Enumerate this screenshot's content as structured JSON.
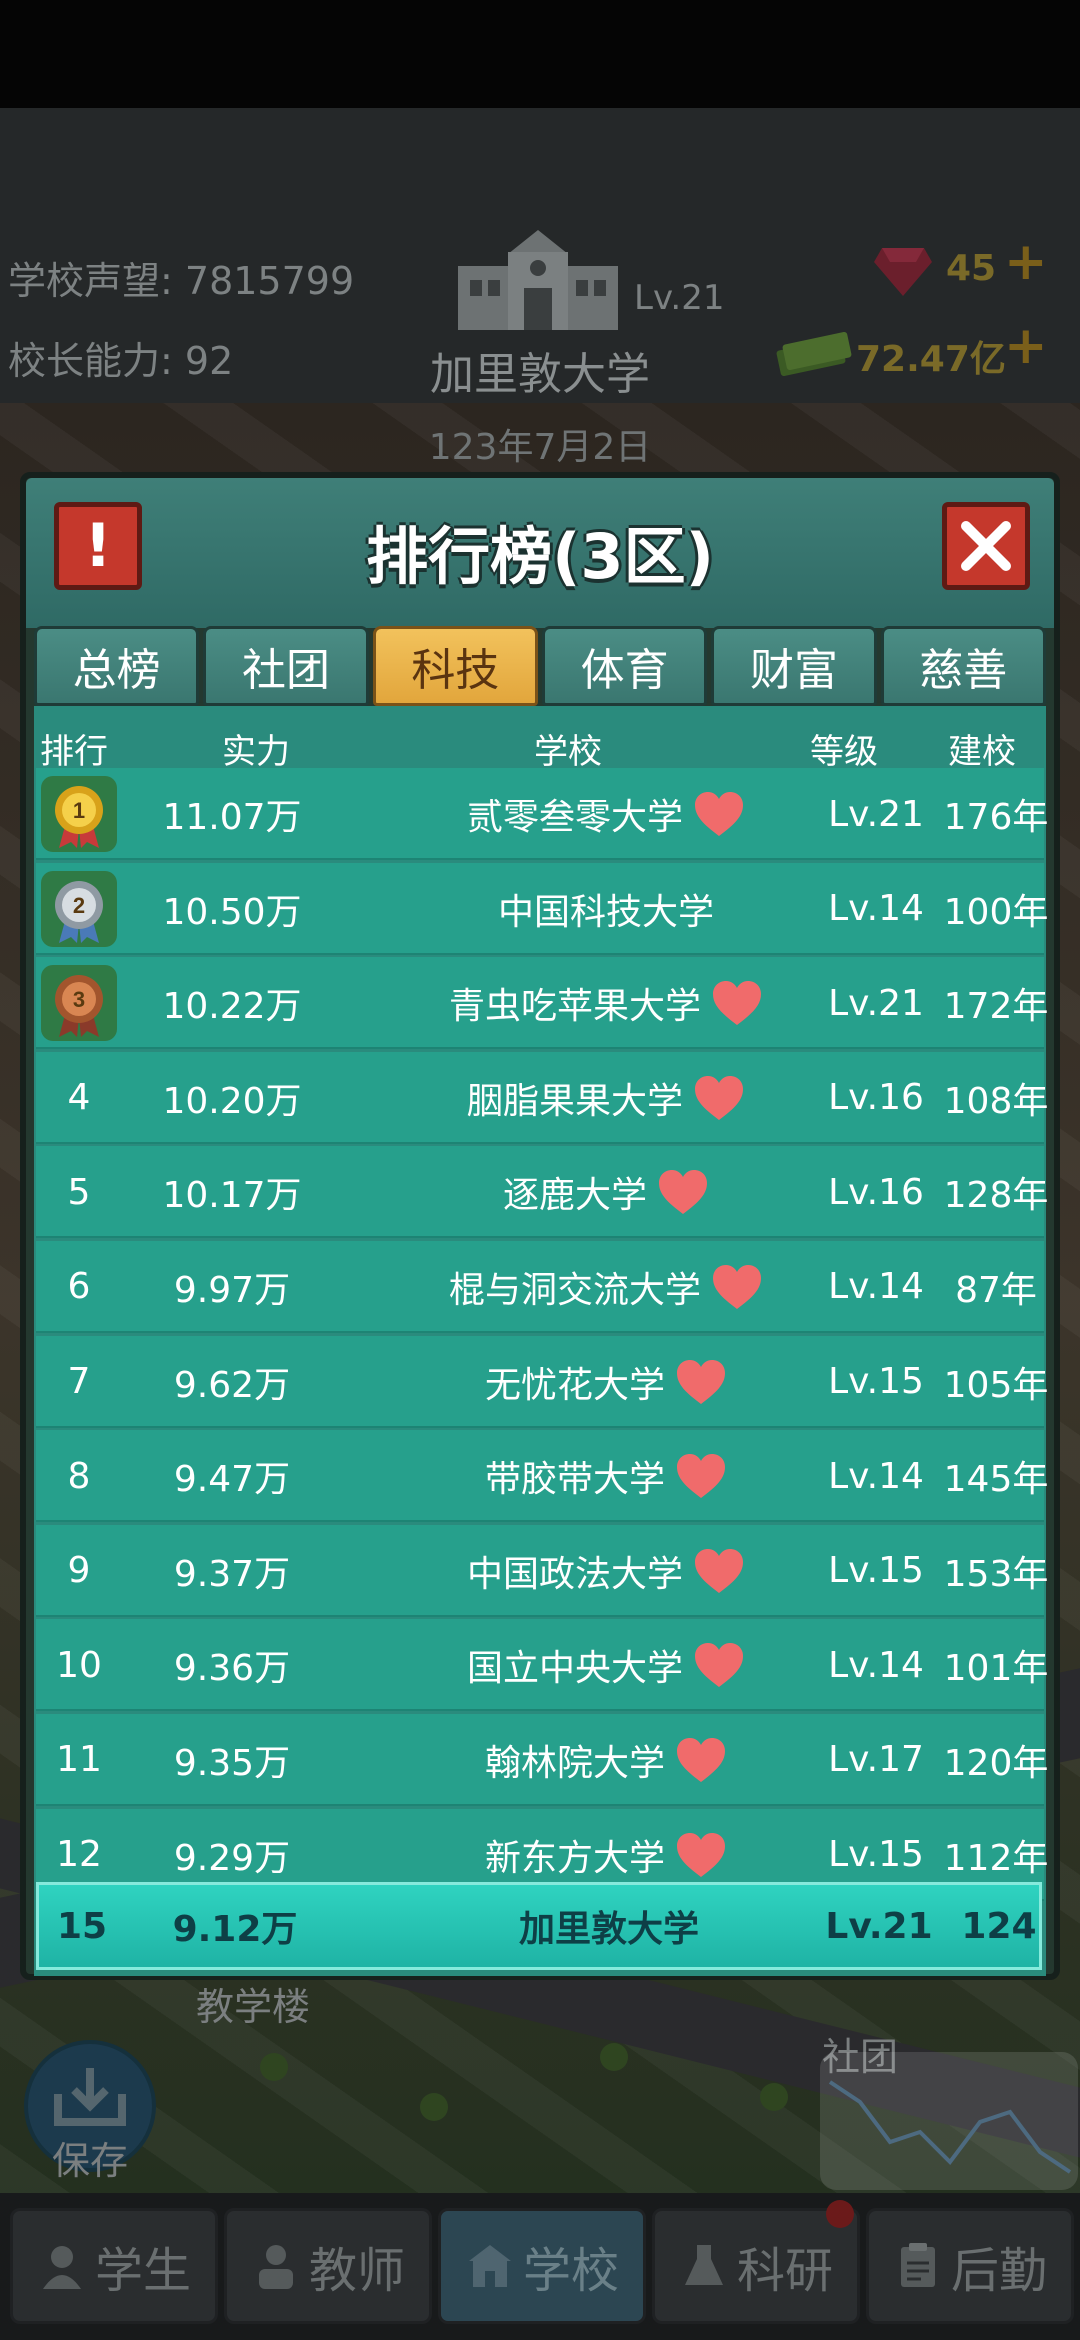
{
  "header": {
    "reputation_label": "学校声望:",
    "reputation_value": "7815799",
    "principal_label": "校长能力:",
    "principal_value": "92",
    "school_level": "Lv.21",
    "school_name": "加里敦大学",
    "date": "123年7月2日",
    "gems": "45",
    "money": "72.47亿"
  },
  "modal": {
    "title": "排行榜(3区)",
    "tabs": [
      {
        "label": "总榜",
        "active": false
      },
      {
        "label": "社团",
        "active": false
      },
      {
        "label": "科技",
        "active": true
      },
      {
        "label": "体育",
        "active": false
      },
      {
        "label": "财富",
        "active": false
      },
      {
        "label": "慈善",
        "active": false
      }
    ],
    "columns": {
      "rank": "排行",
      "power": "实力",
      "school": "学校",
      "level": "等级",
      "age": "建校"
    },
    "rows": [
      {
        "rank": "1",
        "medal": "gold",
        "power": "11.07万",
        "school": "贰零叁零大学",
        "heart": true,
        "level": "Lv.21",
        "age": "176年"
      },
      {
        "rank": "2",
        "medal": "silver",
        "power": "10.50万",
        "school": "中国科技大学",
        "heart": false,
        "level": "Lv.14",
        "age": "100年"
      },
      {
        "rank": "3",
        "medal": "bronze",
        "power": "10.22万",
        "school": "青虫吃苹果大学",
        "heart": true,
        "level": "Lv.21",
        "age": "172年"
      },
      {
        "rank": "4",
        "power": "10.20万",
        "school": "胭脂果果大学",
        "heart": true,
        "level": "Lv.16",
        "age": "108年"
      },
      {
        "rank": "5",
        "power": "10.17万",
        "school": "逐鹿大学",
        "heart": true,
        "level": "Lv.16",
        "age": "128年"
      },
      {
        "rank": "6",
        "power": "9.97万",
        "school": "棍与洞交流大学",
        "heart": true,
        "level": "Lv.14",
        "age": "87年"
      },
      {
        "rank": "7",
        "power": "9.62万",
        "school": "无忧花大学",
        "heart": true,
        "level": "Lv.15",
        "age": "105年"
      },
      {
        "rank": "8",
        "power": "9.47万",
        "school": "带胶带大学",
        "heart": true,
        "level": "Lv.14",
        "age": "145年"
      },
      {
        "rank": "9",
        "power": "9.37万",
        "school": "中国政法大学",
        "heart": true,
        "level": "Lv.15",
        "age": "153年"
      },
      {
        "rank": "10",
        "power": "9.36万",
        "school": "国立中央大学",
        "heart": true,
        "level": "Lv.14",
        "age": "101年"
      },
      {
        "rank": "11",
        "power": "9.35万",
        "school": "翰林院大学",
        "heart": true,
        "level": "Lv.17",
        "age": "120年"
      },
      {
        "rank": "12",
        "power": "9.29万",
        "school": "新东方大学",
        "heart": true,
        "level": "Lv.15",
        "age": "112年"
      }
    ],
    "my_row": {
      "rank": "15",
      "power": "9.12万",
      "school": "加里敦大学",
      "level": "Lv.21",
      "age": "124"
    }
  },
  "background": {
    "teaching_building": "教学楼",
    "club": "社团",
    "save": "保存"
  },
  "bottom_nav": [
    {
      "label": "学生",
      "icon": "student-icon",
      "active": false
    },
    {
      "label": "教师",
      "icon": "teacher-icon",
      "active": false
    },
    {
      "label": "学校",
      "icon": "school-icon",
      "active": true
    },
    {
      "label": "科研",
      "icon": "flask-icon",
      "active": false
    },
    {
      "label": "后勤",
      "icon": "clipboard-icon",
      "active": false
    }
  ],
  "colors": {
    "row_bg": "#26a08c",
    "my_row_bg": "#2fd3c0",
    "tab_active": "#f2c25c",
    "heart": "#f06b6b"
  }
}
